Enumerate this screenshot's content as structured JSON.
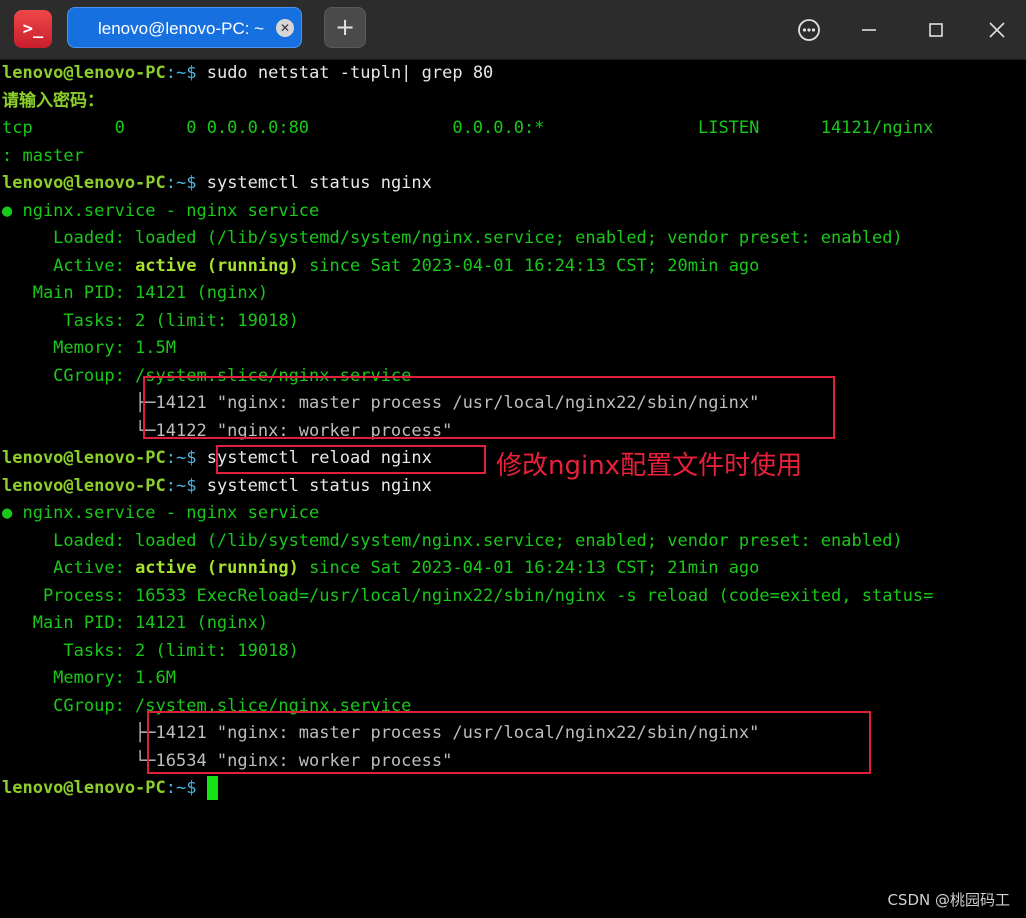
{
  "window": {
    "tab_title": "lenovo@lenovo-PC: ~",
    "app_icon": ">_",
    "icons": {
      "app": "terminal-icon",
      "tab_close": "close-icon",
      "new_tab": "plus-icon",
      "menu": "more-icon",
      "minimize": "minimize-icon",
      "maximize": "maximize-icon",
      "close": "close-icon"
    },
    "colors": {
      "tab_active": "#1670e0",
      "prompt": "#8ccf2b",
      "output": "#19c919",
      "highlight": "#e0203a"
    }
  },
  "terminal": {
    "prompt_user": "lenovo@lenovo-PC",
    "prompt_path": ":~$ ",
    "cmd1": "sudo netstat -tupln| grep 80",
    "password_prompt": "请输入密码：",
    "netstat_row": "tcp        0      0 0.0.0.0:80              0.0.0.0:*               LISTEN      14121/nginx",
    "netstat_cont": ": master",
    "cmd2": "systemctl status nginx",
    "s1": {
      "header": "● nginx.service - nginx service",
      "loaded": "     Loaded: loaded (/lib/systemd/system/nginx.service; enabled; vendor preset: enabled)",
      "active_label": "     Active: ",
      "active_state": "active (running)",
      "active_rest": " since Sat 2023-04-01 16:24:13 CST; 20min ago",
      "main_pid": "   Main PID: 14121 (nginx)",
      "tasks": "      Tasks: 2 (limit: 19018)",
      "memory": "     Memory: 1.5M",
      "cgroup": "     CGroup: /system.slice/nginx.service",
      "proc1": "             ├─14121 \"nginx: master process /usr/local/nginx22/sbin/nginx\"",
      "proc2": "             └─14122 \"nginx: worker process\""
    },
    "cmd3": "systemctl reload nginx",
    "annotation": "修改nginx配置文件时使用",
    "cmd4": "systemctl status nginx",
    "s2": {
      "header": "● nginx.service - nginx service",
      "loaded": "     Loaded: loaded (/lib/systemd/system/nginx.service; enabled; vendor preset: enabled)",
      "active_label": "     Active: ",
      "active_state": "active (running)",
      "active_rest": " since Sat 2023-04-01 16:24:13 CST; 21min ago",
      "process": "    Process: 16533 ExecReload=/usr/local/nginx22/sbin/nginx -s reload (code=exited, status=",
      "main_pid": "   Main PID: 14121 (nginx)",
      "tasks": "      Tasks: 2 (limit: 19018)",
      "memory": "     Memory: 1.6M",
      "cgroup": "     CGroup: /system.slice/nginx.service",
      "proc1": "             ├─14121 \"nginx: master process /usr/local/nginx22/sbin/nginx\"",
      "proc2": "             └─16534 \"nginx: worker process\""
    }
  },
  "watermark": "CSDN @桃园码工"
}
